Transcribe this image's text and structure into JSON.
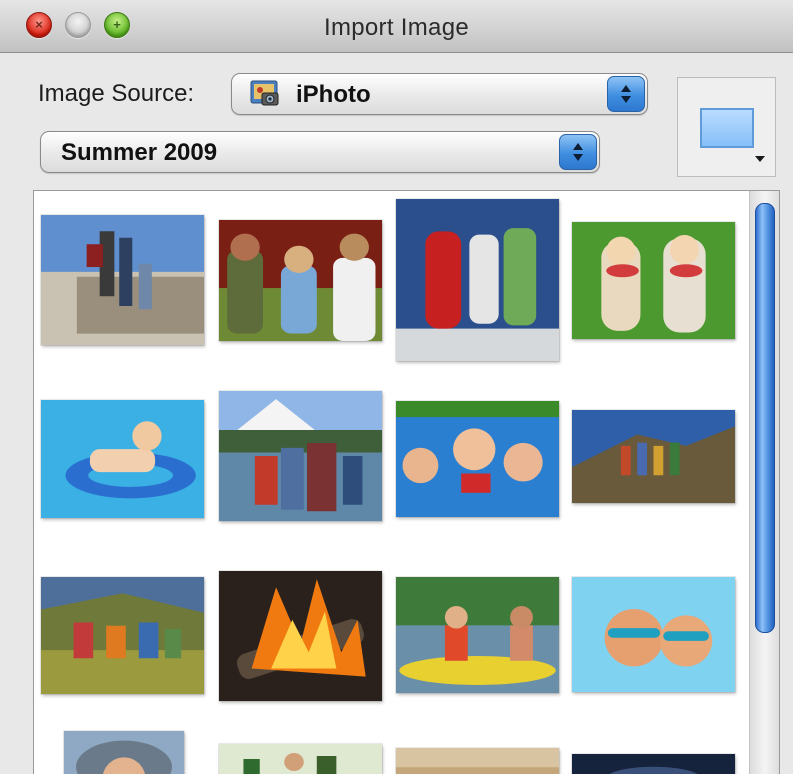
{
  "window": {
    "title": "Import Image",
    "traffic_lights": {
      "close_icon": "close-icon",
      "minimize_icon": "minimize-icon",
      "zoom_icon": "zoom-icon"
    }
  },
  "source": {
    "label": "Image Source:",
    "selected": "iPhoto",
    "icon": "iphoto-icon"
  },
  "album": {
    "selected": "Summer 2009"
  },
  "view_button": {
    "icon": "view-options-icon"
  },
  "photos": [
    {
      "subject": "Hikers on stone wall"
    },
    {
      "subject": "Kids sitting on grass"
    },
    {
      "subject": "Kids with towels at lake"
    },
    {
      "subject": "Girls eating watermelon"
    },
    {
      "subject": "Boy in pool float"
    },
    {
      "subject": "Family by mountain lake"
    },
    {
      "subject": "Kids in swimming pool"
    },
    {
      "subject": "Hikers on hillside"
    },
    {
      "subject": "Group in meadow"
    },
    {
      "subject": "Campfire"
    },
    {
      "subject": "Kayaking"
    },
    {
      "subject": "Boys with goggles"
    },
    {
      "subject": "Child with hat"
    },
    {
      "subject": "Family outdoors"
    },
    {
      "subject": "Sandy scene"
    },
    {
      "subject": "Night sky"
    }
  ],
  "colors": {
    "scroll_thumb": "#4a8de3",
    "stepper": "#3f8ee0",
    "close": "#d81c0e",
    "zoom": "#58b21e"
  }
}
